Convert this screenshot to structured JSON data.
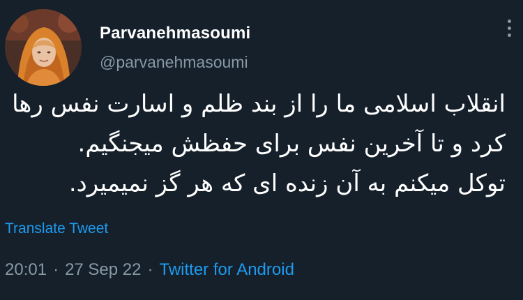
{
  "user": {
    "display_name": "Parvanehmasoumi",
    "handle": "@parvanehmasoumi",
    "avatar_icon": "profile-photo"
  },
  "menu": {
    "icon": "more-vertical-icon"
  },
  "tweet": {
    "lines": [
      "انقلاب اسلامی ما را از بند ظلم و اسارت نفس رها",
      "کرد و تا آخرین نفس برای حفظش میجنگیم.",
      "توکل میکنم به آن زنده ای که هر گز نمیمیرد."
    ],
    "translate_label": "Translate Tweet"
  },
  "meta": {
    "time": "20:01",
    "separator": "·",
    "date": "27 Sep 22",
    "source": "Twitter for Android"
  },
  "colors": {
    "background": "#15202b",
    "text": "#ffffff",
    "secondary": "#8899a6",
    "link": "#1d9bf0"
  }
}
